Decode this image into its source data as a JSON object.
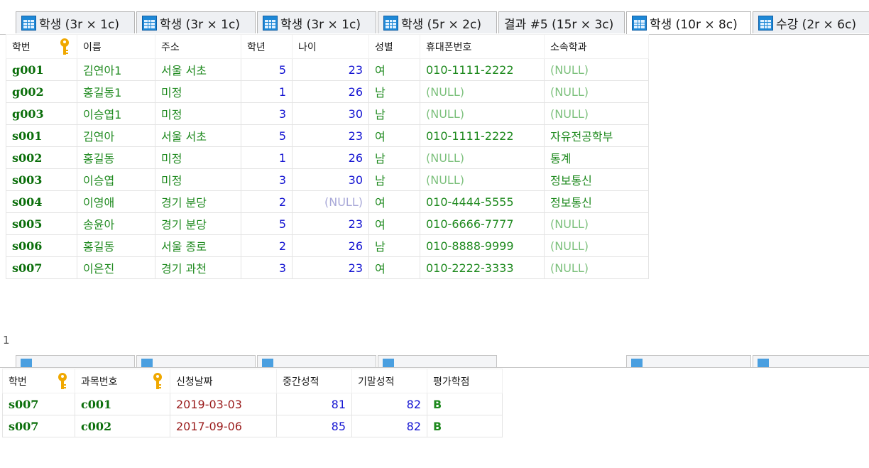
{
  "tabs": [
    {
      "label": "학생 (3r × 1c)"
    },
    {
      "label": "학생 (3r × 1c)"
    },
    {
      "label": "학생 (3r × 1c)"
    },
    {
      "label": "학생 (5r × 2c)"
    },
    {
      "label": "결과 #5 (15r × 3c)"
    },
    {
      "label": "학생 (10r × 8c)"
    },
    {
      "label": "수강 (2r × 6c)"
    }
  ],
  "grid1": {
    "columns": [
      "학번",
      "이름",
      "주소",
      "학년",
      "나이",
      "성별",
      "휴대폰번호",
      "소속학과"
    ],
    "rows": [
      [
        "g001",
        "김연아1",
        "서울 서초",
        "5",
        "23",
        "여",
        "010-1111-2222",
        "(NULL)"
      ],
      [
        "g002",
        "홍길동1",
        "미정",
        "1",
        "26",
        "남",
        "(NULL)",
        "(NULL)"
      ],
      [
        "g003",
        "이승엽1",
        "미정",
        "3",
        "30",
        "남",
        "(NULL)",
        "(NULL)"
      ],
      [
        "s001",
        "김연아",
        "서울 서초",
        "5",
        "23",
        "여",
        "010-1111-2222",
        "자유전공학부"
      ],
      [
        "s002",
        "홍길동",
        "미정",
        "1",
        "26",
        "남",
        "(NULL)",
        "통계"
      ],
      [
        "s003",
        "이승엽",
        "미정",
        "3",
        "30",
        "남",
        "(NULL)",
        "정보통신"
      ],
      [
        "s004",
        "이영애",
        "경기 분당",
        "2",
        "(NULL)",
        "여",
        "010-4444-5555",
        "정보통신"
      ],
      [
        "s005",
        "송윤아",
        "경기 분당",
        "5",
        "23",
        "여",
        "010-6666-7777",
        "(NULL)"
      ],
      [
        "s006",
        "홍길동",
        "서울 종로",
        "2",
        "26",
        "남",
        "010-8888-9999",
        "(NULL)"
      ],
      [
        "s007",
        "이은진",
        "경기 과천",
        "3",
        "23",
        "여",
        "010-2222-3333",
        "(NULL)"
      ]
    ]
  },
  "row_number": "1",
  "grid2": {
    "columns": [
      "학번",
      "과목번호",
      "신청날짜",
      "중간성적",
      "기말성적",
      "평가학점"
    ],
    "rows": [
      [
        "s007",
        "c001",
        "2019-03-03",
        "81",
        "82",
        "B"
      ],
      [
        "s007",
        "c002",
        "2017-09-06",
        "85",
        "82",
        "B"
      ]
    ]
  },
  "icons": {
    "tab": "table-icon",
    "key": "primary-key-icon"
  },
  "colors": {
    "primary_key": "#0a6e0a",
    "string": "#1f8a1f",
    "number": "#1414d2",
    "null": "#7cc07c",
    "date": "#9a1c1c",
    "tab_icon": "#1e88d6",
    "key_icon": "#f0a800"
  }
}
